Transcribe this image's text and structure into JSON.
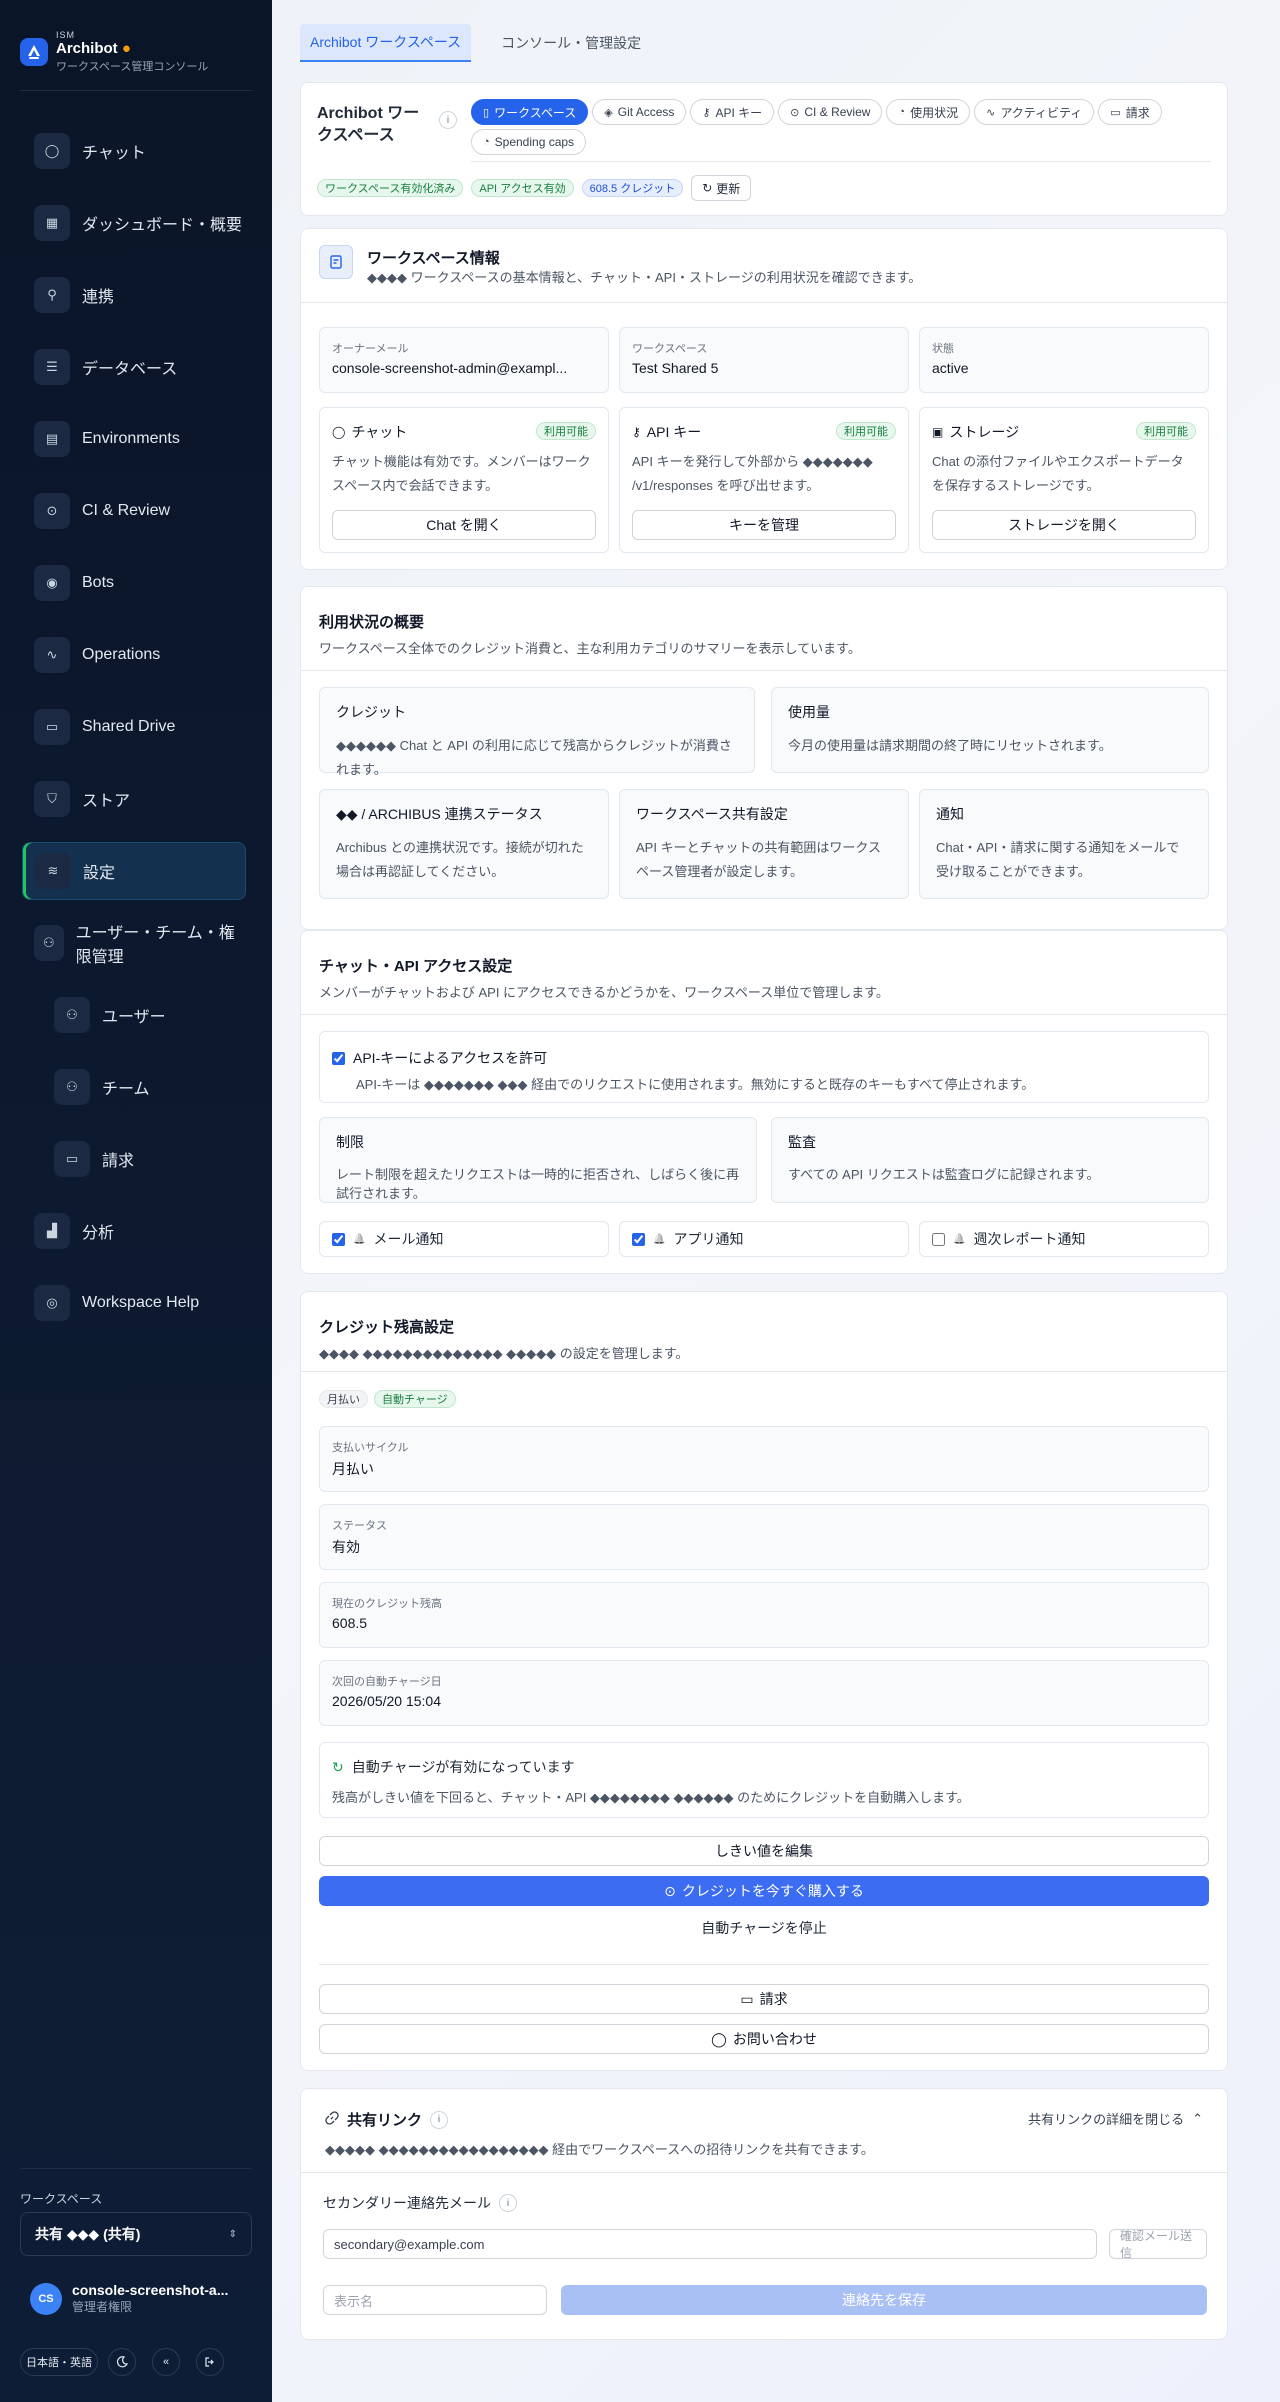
{
  "brand": {
    "small": "ISM",
    "name": "Archibot",
    "subtitle": "ワークスペース管理コンソール"
  },
  "nav": [
    {
      "label": "チャット",
      "icon": "chat-icon"
    },
    {
      "label": "ダッシュボード・概要",
      "icon": "dashboard-icon"
    },
    {
      "label": "連携",
      "icon": "plug-icon"
    },
    {
      "label": "データベース",
      "icon": "database-icon"
    },
    {
      "label": "Environments",
      "icon": "server-icon"
    },
    {
      "label": "CI & Review",
      "icon": "check-circle-icon"
    },
    {
      "label": "Bots",
      "icon": "bot-icon"
    },
    {
      "label": "Operations",
      "icon": "pulse-icon"
    },
    {
      "label": "Shared Drive",
      "icon": "folder-icon"
    },
    {
      "label": "ストア",
      "icon": "cart-icon"
    },
    {
      "label": "設定",
      "icon": "sliders-icon"
    },
    {
      "label": "ユーザー・チーム・権限管理",
      "icon": "users-icon"
    },
    {
      "label": "ユーザー",
      "icon": "user-icon"
    },
    {
      "label": "チーム",
      "icon": "team-icon"
    },
    {
      "label": "請求",
      "icon": "card-icon"
    },
    {
      "label": "分析",
      "icon": "chart-icon"
    },
    {
      "label": "Workspace Help",
      "icon": "help-icon"
    }
  ],
  "sidebar_bottom": {
    "ws_label": "ワークスペース",
    "ws_value": "共有 ◆◆◆ (共有)",
    "user_name": "console-screenshot-a...",
    "user_role": "管理者権限",
    "user_initials": "CS",
    "lang_button": "日本語・英語"
  },
  "tabs": [
    "Archibot ワークスペース",
    "コンソール・管理設定"
  ],
  "header": {
    "title": "Archibot ワークスペース",
    "pills": [
      {
        "label": "ワークスペース",
        "icon": "doc-icon"
      },
      {
        "label": "Git Access",
        "icon": "git-icon"
      },
      {
        "label": "API キー",
        "icon": "key-icon"
      },
      {
        "label": "CI & Review",
        "icon": "check-circle-icon"
      },
      {
        "label": "使用状況",
        "icon": "gauge-icon"
      },
      {
        "label": "アクティビティ",
        "icon": "pulse-icon"
      },
      {
        "label": "請求",
        "icon": "card-icon"
      },
      {
        "label": "Spending caps",
        "icon": "gauge-icon"
      }
    ],
    "badges": [
      "ワークスペース有効化済み",
      "API アクセス有効",
      "608.5 クレジット"
    ],
    "refresh": "更新"
  },
  "ws_section": {
    "title": "ワークスペース情報",
    "desc": "◆◆◆◆ ワークスペースの基本情報と、チャット・API・ストレージの利用状況を確認できます。",
    "fields": [
      {
        "label": "オーナーメール",
        "value": "console-screenshot-admin@exampl..."
      },
      {
        "label": "ワークスペース",
        "value": "Test Shared 5"
      },
      {
        "label": "状態",
        "value": "active"
      }
    ],
    "features": [
      {
        "title": "チャット",
        "badge": "利用可能",
        "desc": "チャット機能は有効です。メンバーはワークスペース内で会話できます。",
        "button": "Chat を開く",
        "icon": "chat-icon"
      },
      {
        "title": "API キー",
        "badge": "利用可能",
        "desc": "API キーを発行して外部から ◆◆◆◆◆◆◆ /v1/responses を呼び出せます。",
        "button": "キーを管理",
        "icon": "key-icon"
      },
      {
        "title": "ストレージ",
        "badge": "利用可能",
        "desc": "Chat の添付ファイルやエクスポートデータを保存するストレージです。",
        "button": "ストレージを開く",
        "icon": "archive-icon"
      }
    ]
  },
  "usage_section": {
    "title": "利用状況の概要",
    "desc": "ワークスペース全体でのクレジット消費と、主な利用カテゴリのサマリーを表示しています。",
    "boxes": [
      {
        "title": "クレジット",
        "desc": "◆◆◆◆◆◆ Chat と API の利用に応じて残高からクレジットが消費されます。"
      },
      {
        "title": "使用量",
        "desc": "今月の使用量は請求期間の終了時にリセットされます。"
      },
      {
        "title": "◆◆ / ARCHIBUS 連携ステータス",
        "desc": "Archibus との連携状況です。接続が切れた場合は再認証してください。"
      },
      {
        "title": "ワークスペース共有設定",
        "desc": "API キーとチャットの共有範囲はワークスペース管理者が設定します。"
      },
      {
        "title": "通知",
        "desc": "Chat・API・請求に関する通知をメールで受け取ることができます。"
      }
    ]
  },
  "api_section": {
    "title": "チャット・API アクセス設定",
    "desc": "メンバーがチャットおよび API にアクセスできるかどうかを、ワークスペース単位で管理します。",
    "check_title": "API-キーによるアクセスを許可",
    "check_desc": "API-キーは ◆◆◆◆◆◆◆ ◆◆◆ 経由でのリクエストに使用されます。無効にすると既存のキーもすべて停止されます。",
    "boxes": [
      {
        "title": "制限",
        "desc": "レート制限を超えたリクエストは一時的に拒否され、しばらく後に再試行されます。"
      },
      {
        "title": "監査",
        "desc": "すべての API リクエストは監査ログに記録されます。"
      }
    ],
    "toggles": [
      {
        "label": "メール通知",
        "checked": true
      },
      {
        "label": "アプリ通知",
        "checked": true
      },
      {
        "label": "週次レポート通知",
        "checked": false
      }
    ]
  },
  "credit_section": {
    "title": "クレジット残高設定",
    "desc": "◆◆◆◆ ◆◆◆◆◆◆◆◆◆◆◆◆◆◆ ◆◆◆◆◆ の設定を管理します。",
    "badges": [
      "月払い",
      "自動チャージ"
    ],
    "fields": [
      {
        "label": "支払いサイクル",
        "value": "月払い"
      },
      {
        "label": "ステータス",
        "value": "有効"
      },
      {
        "label": "現在のクレジット残高",
        "value": "608.5"
      },
      {
        "label": "次回の自動チャージ日",
        "value": "2026/05/20 15:04"
      }
    ],
    "auto_title": "自動チャージが有効になっています",
    "auto_desc": "残高がしきい値を下回ると、チャット・API ◆◆◆◆◆◆◆◆ ◆◆◆◆◆◆ のためにクレジットを自動購入します。",
    "btn_edit": "しきい値を編集",
    "btn_primary": "クレジットを今すぐ購入する",
    "link": "自動チャージを停止",
    "btn_billing": "請求",
    "btn_contact": "お問い合わせ"
  },
  "share_section": {
    "title": "共有リンク",
    "desc": "◆◆◆◆◆ ◆◆◆◆◆◆◆◆◆◆◆◆◆◆◆◆◆ 経由でワークスペースへの招待リンクを共有できます。",
    "collapse": "共有リンクの詳細を閉じる",
    "sub_title": "セカンダリー連絡先メール",
    "email_value": "secondary@example.com",
    "verify": "確認メール送信",
    "name_placeholder": "表示名",
    "save": "連絡先を保存"
  }
}
